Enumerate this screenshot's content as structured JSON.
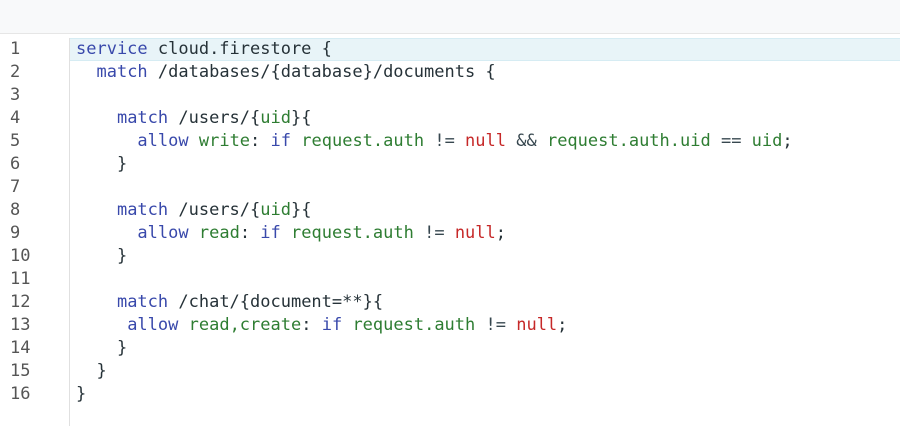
{
  "editor": {
    "lines": [
      {
        "n": "1",
        "tokens": [
          [
            "kw",
            "service"
          ],
          [
            "txt",
            " cloud.firestore {"
          ]
        ]
      },
      {
        "n": "2",
        "tokens": [
          [
            "txt",
            "  "
          ],
          [
            "kw",
            "match"
          ],
          [
            "txt",
            " /databases/{database}/documents {"
          ]
        ]
      },
      {
        "n": "3",
        "tokens": []
      },
      {
        "n": "4",
        "tokens": [
          [
            "txt",
            "    "
          ],
          [
            "kw",
            "match"
          ],
          [
            "txt",
            " /users/{"
          ],
          [
            "id",
            "uid"
          ],
          [
            "txt",
            "}{"
          ]
        ]
      },
      {
        "n": "5",
        "tokens": [
          [
            "txt",
            "      "
          ],
          [
            "kw",
            "allow"
          ],
          [
            "txt",
            " "
          ],
          [
            "id",
            "write"
          ],
          [
            "txt",
            ": "
          ],
          [
            "kw",
            "if"
          ],
          [
            "txt",
            " "
          ],
          [
            "id",
            "request.auth"
          ],
          [
            "op",
            " != "
          ],
          [
            "nul",
            "null"
          ],
          [
            "op",
            " && "
          ],
          [
            "id",
            "request.auth.uid"
          ],
          [
            "op",
            " == "
          ],
          [
            "id",
            "uid"
          ],
          [
            "txt",
            ";"
          ]
        ]
      },
      {
        "n": "6",
        "tokens": [
          [
            "txt",
            "    }"
          ]
        ]
      },
      {
        "n": "7",
        "tokens": []
      },
      {
        "n": "8",
        "tokens": [
          [
            "txt",
            "    "
          ],
          [
            "kw",
            "match"
          ],
          [
            "txt",
            " /users/{"
          ],
          [
            "id",
            "uid"
          ],
          [
            "txt",
            "}{"
          ]
        ]
      },
      {
        "n": "9",
        "tokens": [
          [
            "txt",
            "      "
          ],
          [
            "kw",
            "allow"
          ],
          [
            "txt",
            " "
          ],
          [
            "id",
            "read"
          ],
          [
            "txt",
            ": "
          ],
          [
            "kw",
            "if"
          ],
          [
            "txt",
            " "
          ],
          [
            "id",
            "request.auth"
          ],
          [
            "op",
            " != "
          ],
          [
            "nul",
            "null"
          ],
          [
            "txt",
            ";"
          ]
        ]
      },
      {
        "n": "10",
        "tokens": [
          [
            "txt",
            "    }"
          ]
        ]
      },
      {
        "n": "11",
        "tokens": []
      },
      {
        "n": "12",
        "tokens": [
          [
            "txt",
            "    "
          ],
          [
            "kw",
            "match"
          ],
          [
            "txt",
            " /chat/{document=**}{"
          ]
        ]
      },
      {
        "n": "13",
        "tokens": [
          [
            "txt",
            "     "
          ],
          [
            "kw",
            "allow"
          ],
          [
            "txt",
            " "
          ],
          [
            "id",
            "read,create"
          ],
          [
            "txt",
            ": "
          ],
          [
            "kw",
            "if"
          ],
          [
            "txt",
            " "
          ],
          [
            "id",
            "request.auth"
          ],
          [
            "op",
            " != "
          ],
          [
            "nul",
            "null"
          ],
          [
            "txt",
            ";"
          ]
        ]
      },
      {
        "n": "14",
        "tokens": [
          [
            "txt",
            "    }"
          ]
        ]
      },
      {
        "n": "15",
        "tokens": [
          [
            "txt",
            "  }"
          ]
        ]
      },
      {
        "n": "16",
        "tokens": [
          [
            "txt",
            "}"
          ]
        ]
      }
    ],
    "active_line": "1",
    "colors": {
      "keyword": "#3949ab",
      "identifier": "#2e7d32",
      "null": "#c62828",
      "text": "#263238",
      "active_line_bg": "#e8f4f8"
    }
  }
}
